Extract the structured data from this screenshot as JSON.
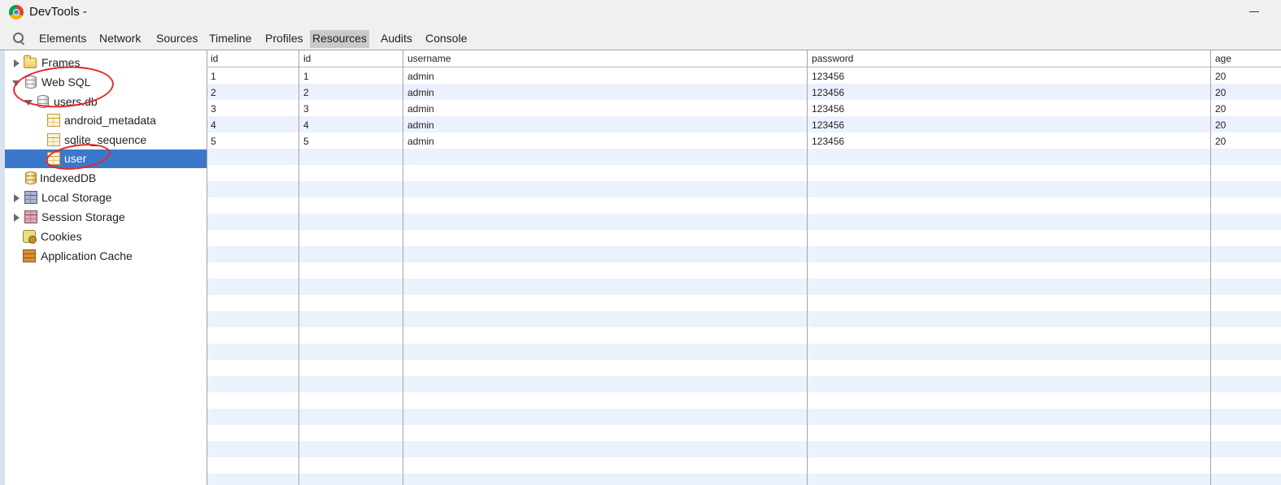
{
  "window": {
    "title": "DevTools -"
  },
  "toolbar": {
    "tabs": [
      {
        "label": "Elements",
        "selected": false
      },
      {
        "label": "Network",
        "selected": false
      },
      {
        "label": "Sources",
        "selected": false
      },
      {
        "label": "Timeline",
        "selected": false
      },
      {
        "label": "Profiles",
        "selected": false
      },
      {
        "label": "Resources",
        "selected": true
      },
      {
        "label": "Audits",
        "selected": false
      },
      {
        "label": "Console",
        "selected": false
      }
    ]
  },
  "sidebar": {
    "items": [
      {
        "label": "Frames",
        "icon": "folder-icon",
        "expanded": false,
        "selected": false
      },
      {
        "label": "Web SQL",
        "icon": "database-icon",
        "expanded": true,
        "selected": false
      },
      {
        "label": "users.db",
        "icon": "database-icon",
        "expanded": true,
        "selected": false
      },
      {
        "label": "android_metadata",
        "icon": "table-icon",
        "selected": false
      },
      {
        "label": "sqlite_sequence",
        "icon": "table-icon",
        "selected": false
      },
      {
        "label": "user",
        "icon": "table-icon",
        "selected": true
      },
      {
        "label": "IndexedDB",
        "icon": "database-icon",
        "selected": false
      },
      {
        "label": "Local Storage",
        "icon": "grid-icon",
        "expanded": false,
        "selected": false
      },
      {
        "label": "Session Storage",
        "icon": "grid-icon",
        "expanded": false,
        "selected": false
      },
      {
        "label": "Cookies",
        "icon": "cookie-icon",
        "selected": false
      },
      {
        "label": "Application Cache",
        "icon": "app-cache-icon",
        "selected": false
      }
    ]
  },
  "table": {
    "columns": [
      "id",
      "id",
      "username",
      "password",
      "age"
    ],
    "rows": [
      [
        "1",
        "1",
        "admin",
        "123456",
        "20"
      ],
      [
        "2",
        "2",
        "admin",
        "123456",
        "20"
      ],
      [
        "3",
        "3",
        "admin",
        "123456",
        "20"
      ],
      [
        "4",
        "4",
        "admin",
        "123456",
        "20"
      ],
      [
        "5",
        "5",
        "admin",
        "123456",
        "20"
      ]
    ]
  },
  "colors": {
    "selection": "#3b78c9",
    "row_stripe": "#ebf2fd",
    "annotation_circle": "#e8262b"
  }
}
